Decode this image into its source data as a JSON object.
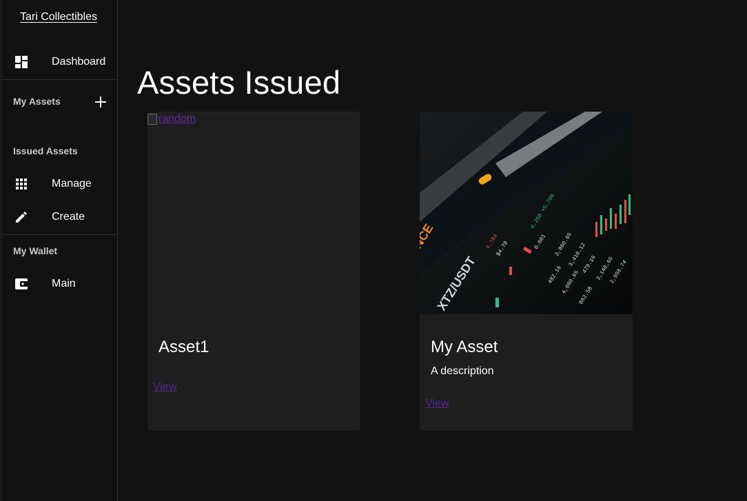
{
  "sidebar": {
    "brand": "Tari Collectibles",
    "dashboard_label": "Dashboard",
    "my_assets_heading": "My Assets",
    "issued_assets_heading": "Issued Assets",
    "manage_label": "Manage",
    "create_label": "Create",
    "my_wallet_heading": "My Wallet",
    "main_label": "Main"
  },
  "main": {
    "title": "Assets Issued",
    "cards": [
      {
        "image_alt": "random",
        "title": "Asset1",
        "description": "",
        "link": "View"
      },
      {
        "title": "My Asset",
        "description": "A description",
        "link": "View"
      }
    ]
  },
  "colors": {
    "background": "#121212",
    "card": "#1e1e1e",
    "link": "#4f2a8f"
  }
}
